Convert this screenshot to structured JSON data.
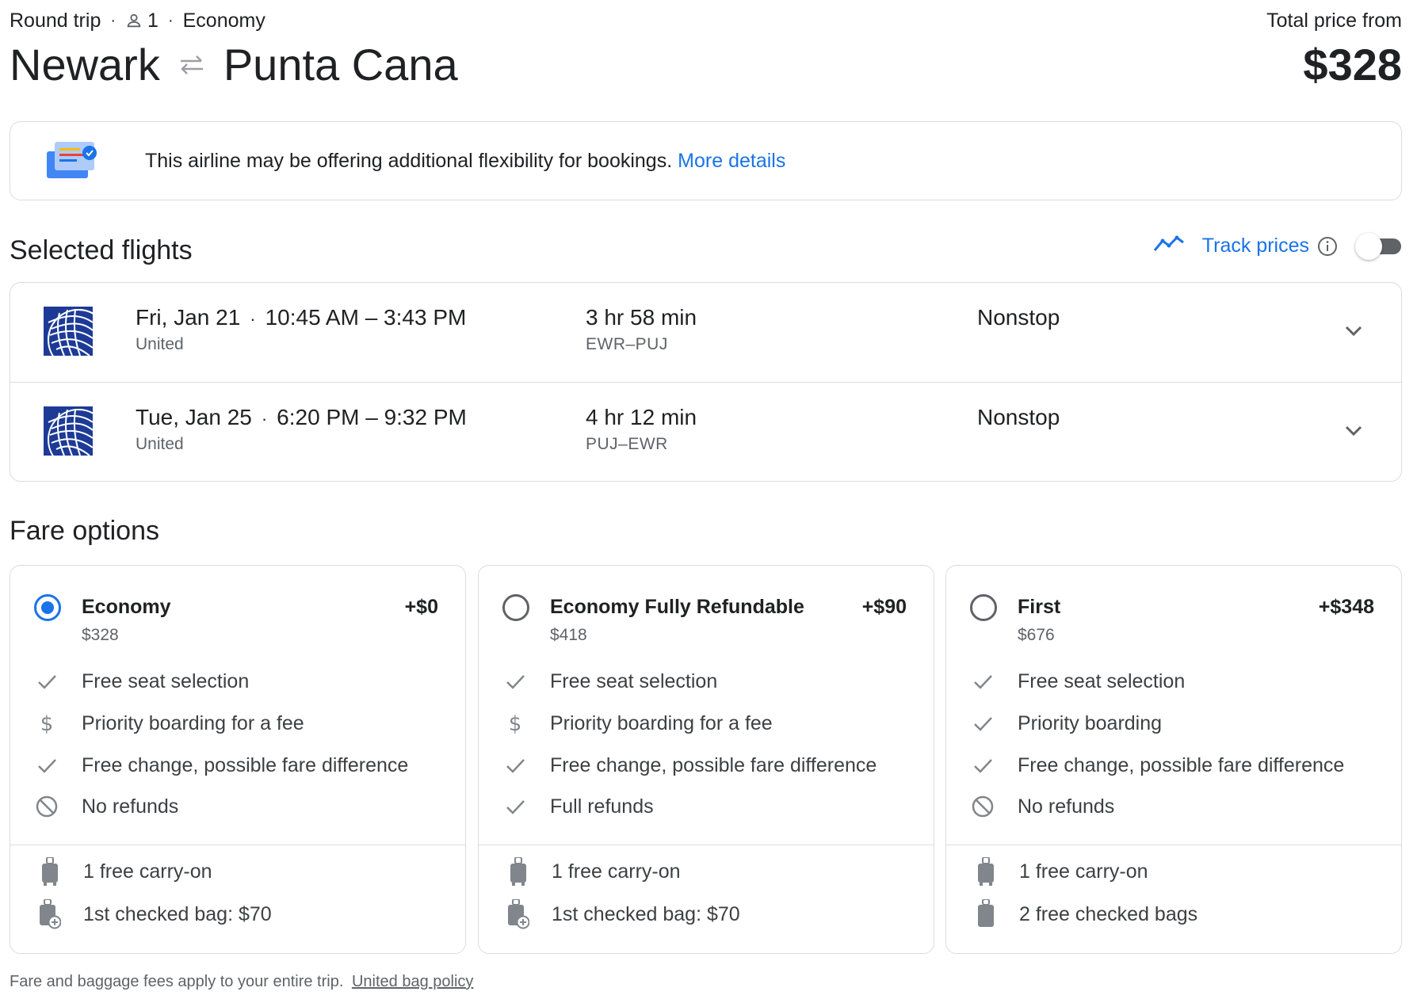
{
  "header": {
    "trip_type": "Round trip",
    "passengers": "1",
    "cabin": "Economy",
    "origin": "Newark",
    "destination": "Punta Cana",
    "price_label": "Total price from",
    "price": "$328"
  },
  "banner": {
    "text": "This airline may be offering additional flexibility for bookings.",
    "link": "More details"
  },
  "selected_flights": {
    "title": "Selected flights",
    "track_label": "Track prices",
    "track_enabled": false,
    "flights": [
      {
        "date": "Fri, Jan 21",
        "times": "10:45 AM – 3:43 PM",
        "airline": "United",
        "duration": "3 hr 58 min",
        "route": "EWR–PUJ",
        "stops": "Nonstop"
      },
      {
        "date": "Tue, Jan 25",
        "times": "6:20 PM – 9:32 PM",
        "airline": "United",
        "duration": "4 hr 12 min",
        "route": "PUJ–EWR",
        "stops": "Nonstop"
      }
    ]
  },
  "fare_options": {
    "title": "Fare options",
    "fares": [
      {
        "name": "Economy",
        "price": "$328",
        "add": "+$0",
        "selected": true,
        "features": [
          {
            "icon": "check-icon",
            "text": "Free seat selection"
          },
          {
            "icon": "dollar-icon",
            "text": "Priority boarding for a fee"
          },
          {
            "icon": "check-icon",
            "text": "Free change, possible fare difference"
          },
          {
            "icon": "no-icon",
            "text": "No refunds"
          }
        ],
        "bags": [
          {
            "icon": "carry-on-icon",
            "text": "1 free carry-on"
          },
          {
            "icon": "checked-bag-fee-icon",
            "text": "1st checked bag: $70"
          }
        ]
      },
      {
        "name": "Economy Fully Refundable",
        "price": "$418",
        "add": "+$90",
        "selected": false,
        "features": [
          {
            "icon": "check-icon",
            "text": "Free seat selection"
          },
          {
            "icon": "dollar-icon",
            "text": "Priority boarding for a fee"
          },
          {
            "icon": "check-icon",
            "text": "Free change, possible fare difference"
          },
          {
            "icon": "check-icon",
            "text": "Full refunds"
          }
        ],
        "bags": [
          {
            "icon": "carry-on-icon",
            "text": "1 free carry-on"
          },
          {
            "icon": "checked-bag-fee-icon",
            "text": "1st checked bag: $70"
          }
        ]
      },
      {
        "name": "First",
        "price": "$676",
        "add": "+$348",
        "selected": false,
        "features": [
          {
            "icon": "check-icon",
            "text": "Free seat selection"
          },
          {
            "icon": "check-icon",
            "text": "Priority boarding"
          },
          {
            "icon": "check-icon",
            "text": "Free change, possible fare difference"
          },
          {
            "icon": "no-icon",
            "text": "No refunds"
          }
        ],
        "bags": [
          {
            "icon": "carry-on-icon",
            "text": "1 free carry-on"
          },
          {
            "icon": "checked-bag-icon",
            "text": "2 free checked bags"
          }
        ]
      }
    ]
  },
  "footer": {
    "text": "Fare and baggage fees apply to your entire trip.",
    "link": "United bag policy"
  },
  "colors": {
    "accent": "#1a73e8",
    "text_primary": "#202124",
    "text_secondary": "#5f6368",
    "border": "#dadce0",
    "united_blue": "#1d3b96"
  }
}
